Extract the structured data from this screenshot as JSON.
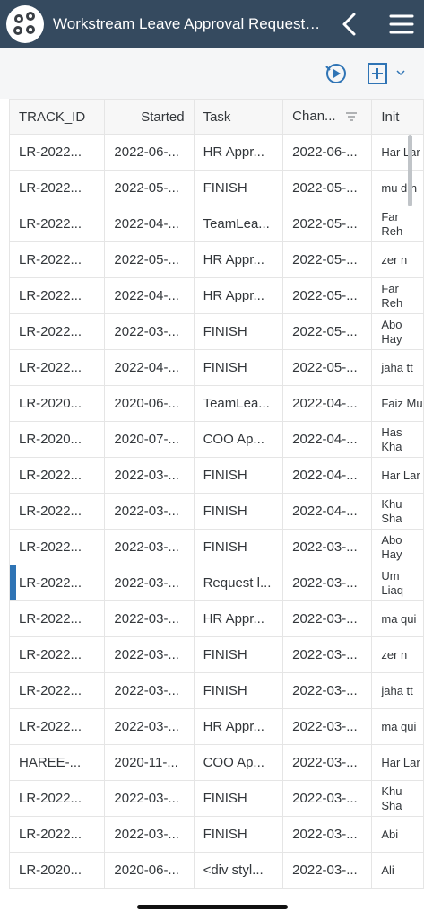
{
  "header": {
    "title": "Workstream Leave Approval Request Pr...",
    "icons": [
      "logo-icon",
      "back-chevron-icon",
      "hamburger-menu-icon"
    ]
  },
  "toolbar": {
    "icons": [
      "run-play-icon",
      "add-column-icon",
      "chevron-down-icon"
    ]
  },
  "table": {
    "columns": [
      "TRACK_ID",
      "Started",
      "Task",
      "Chan...",
      "Init"
    ],
    "rows": [
      [
        "LR-2022...",
        "2022-06-...",
        "HR Appr...",
        "2022-06-...",
        "Har Lar"
      ],
      [
        "LR-2022...",
        "2022-05-...",
        "FINISH",
        "2022-05-...",
        "mu d.n"
      ],
      [
        "LR-2022...",
        "2022-04-...",
        "TeamLea...",
        "2022-05-...",
        "Far Reh"
      ],
      [
        "LR-2022...",
        "2022-05-...",
        "HR Appr...",
        "2022-05-...",
        "zer n"
      ],
      [
        "LR-2022...",
        "2022-04-...",
        "HR Appr...",
        "2022-05-...",
        "Far Reh"
      ],
      [
        "LR-2022...",
        "2022-03-...",
        "FINISH",
        "2022-05-...",
        "Abo Hay"
      ],
      [
        "LR-2022...",
        "2022-04-...",
        "FINISH",
        "2022-05-...",
        "jaha tt"
      ],
      [
        "LR-2020...",
        "2020-06-...",
        "TeamLea...",
        "2022-04-...",
        "Faiz Mu"
      ],
      [
        "LR-2020...",
        "2020-07-...",
        "COO Ap...",
        "2022-04-...",
        "Has Kha"
      ],
      [
        "LR-2022...",
        "2022-03-...",
        "FINISH",
        "2022-04-...",
        "Har Lar"
      ],
      [
        "LR-2022...",
        "2022-03-...",
        "FINISH",
        "2022-04-...",
        "Khu Sha"
      ],
      [
        "LR-2022...",
        "2022-03-...",
        "FINISH",
        "2022-03-...",
        "Abo Hay"
      ],
      [
        "LR-2022...",
        "2022-03-...",
        "Request l...",
        "2022-03-...",
        "Um Liaq"
      ],
      [
        "LR-2022...",
        "2022-03-...",
        "HR Appr...",
        "2022-03-...",
        "ma qui"
      ],
      [
        "LR-2022...",
        "2022-03-...",
        "FINISH",
        "2022-03-...",
        "zer n"
      ],
      [
        "LR-2022...",
        "2022-03-...",
        "FINISH",
        "2022-03-...",
        "jaha tt"
      ],
      [
        "LR-2022...",
        "2022-03-...",
        "HR Appr...",
        "2022-03-...",
        "ma qui"
      ],
      [
        "HAREE-...",
        "2020-11-...",
        "COO Ap...",
        "2022-03-...",
        "Har Lar"
      ],
      [
        "LR-2022...",
        "2022-03-...",
        "FINISH",
        "2022-03-...",
        "Khu Sha"
      ],
      [
        "LR-2022...",
        "2022-03-...",
        "FINISH",
        "2022-03-...",
        "Abi"
      ],
      [
        "LR-2020...",
        "2020-06-...",
        "<div styl...",
        "2022-03-...",
        "Ali"
      ]
    ],
    "selected_row_index": 12
  },
  "colors": {
    "header_bg": "#354a5f",
    "accent": "#2f74b5",
    "toolbar_bg": "#f5f6f7"
  }
}
